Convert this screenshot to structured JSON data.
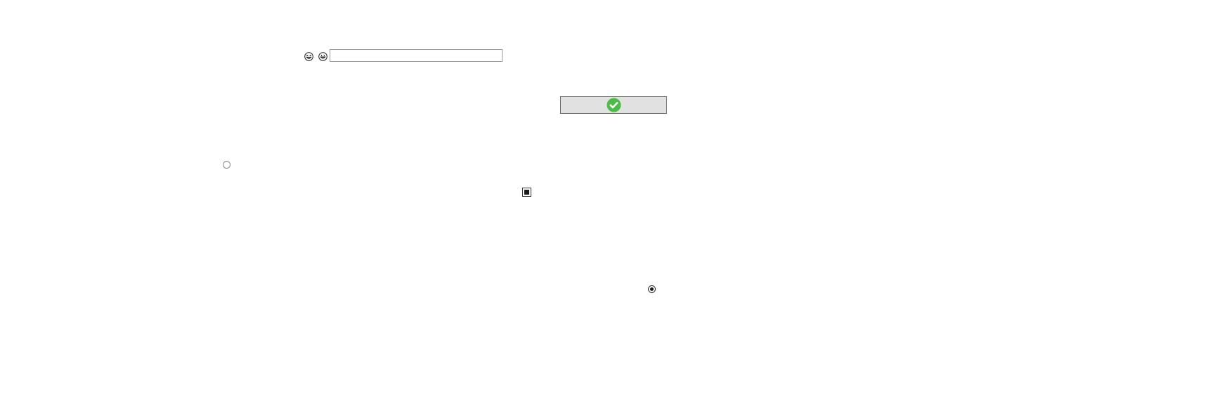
{
  "icons": {
    "emoji_1": "grinning-squinting-face-icon",
    "emoji_2": "grinning-face-icon",
    "confirm": "check-circle-icon"
  },
  "text_input": {
    "value": "",
    "placeholder": ""
  },
  "confirm_button": {
    "icon_color": "#4cbb47"
  },
  "radio_1": {
    "checked": false
  },
  "radio_2": {
    "checked": true
  },
  "checkbox": {
    "checked": true
  }
}
